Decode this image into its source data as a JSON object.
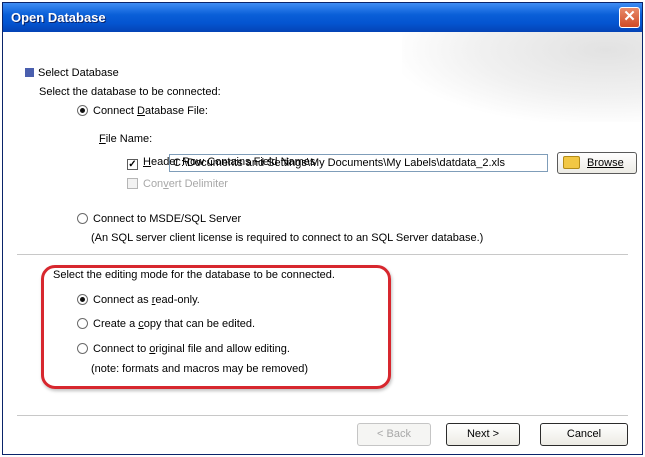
{
  "window": {
    "title": "Open Database",
    "close_glyph": "✕"
  },
  "section": {
    "heading": "Select Database",
    "prompt": "Select the database to be connected:"
  },
  "file_option": {
    "label_pre": "Connect ",
    "label_key": "D",
    "label_post": "atabase File:",
    "selected": true
  },
  "file_name": {
    "label_key": "F",
    "label_rest": "ile Name:",
    "value": "C:\\Documents and Settings\\My Documents\\My Labels\\datdata_2.xls"
  },
  "browse": {
    "label_key": "B",
    "label_rest": "rowse"
  },
  "header_row": {
    "label_key": "H",
    "label_rest": "eader Row Contains Field Names",
    "checked": true,
    "check_glyph": "✓"
  },
  "convert": {
    "label_pre": "Con",
    "label_key": "v",
    "label_post": "ert Delimiter",
    "enabled": false
  },
  "sql_option": {
    "label": "Connect to MSDE/SQL Server",
    "note": "(An SQL server client license is required to connect to an SQL Server database.)",
    "selected": false
  },
  "editing": {
    "prompt": "Select the editing mode for the database to be connected.",
    "readonly": {
      "pre": "Connect as ",
      "key": "r",
      "post": "ead-only.",
      "selected": true
    },
    "copy": {
      "pre": "Create a ",
      "key": "c",
      "post": "opy that can be edited.",
      "selected": false
    },
    "original": {
      "pre": "Connect to ",
      "key": "o",
      "post": "riginal file and allow editing.",
      "selected": false
    },
    "note": "(note:  formats and macros may be removed)"
  },
  "buttons": {
    "back": "< Back",
    "next": "Next >",
    "cancel": "Cancel"
  },
  "colors": {
    "title_bar": "#0454d0",
    "highlight": "#d7272e",
    "section_marker": "#4a5fae"
  }
}
